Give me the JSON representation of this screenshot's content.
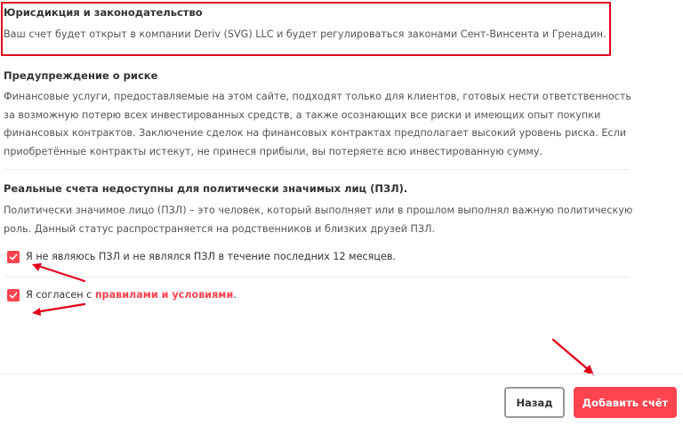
{
  "jurisdiction": {
    "title": "Юрисдикция и законодательство",
    "text": "Ваш счет будет открыт в компании Deriv (SVG) LLC и будет регулироваться законами Сент-Винсента и Гренадин."
  },
  "risk": {
    "title": "Предупреждение о риске",
    "text": "Финансовые услуги, предоставляемые на этом сайте, подходят только для клиентов, готовых нести ответственность за возможную потерю всех инвестированных средств, а также осознающих все риски и имеющих опыт покупки финансовых контрактов. Заключение сделок на финансовых контрактах предполагает высокий уровень риска. Если приобретённые контракты истекут, не принеся прибыли, вы потеряете всю инвестированную сумму."
  },
  "pep": {
    "title": "Реальные счета недоступны для политически значимых лиц (ПЗЛ).",
    "text": "Политически значимое лицо (ПЗЛ) – это человек, который выполняет или в прошлом выполнял важную политическую роль. Данный статус распространяется на родственников и близких друзей ПЗЛ."
  },
  "checkboxes": {
    "not_pep": {
      "label": "Я не являюсь ПЗЛ и не являлся ПЗЛ в течение последних 12 месяцев.",
      "checked": true
    },
    "terms": {
      "label_prefix": "Я согласен с ",
      "link_text": "правилами и условиями",
      "label_suffix": ".",
      "checked": true
    }
  },
  "footer": {
    "back_label": "Назад",
    "add_label": "Добавить счёт"
  },
  "colors": {
    "accent": "#ff444f",
    "annotation_red": "#e2001a"
  },
  "icons": {
    "checkbox": "checkmark-icon",
    "annotation": "arrow-annotation"
  }
}
